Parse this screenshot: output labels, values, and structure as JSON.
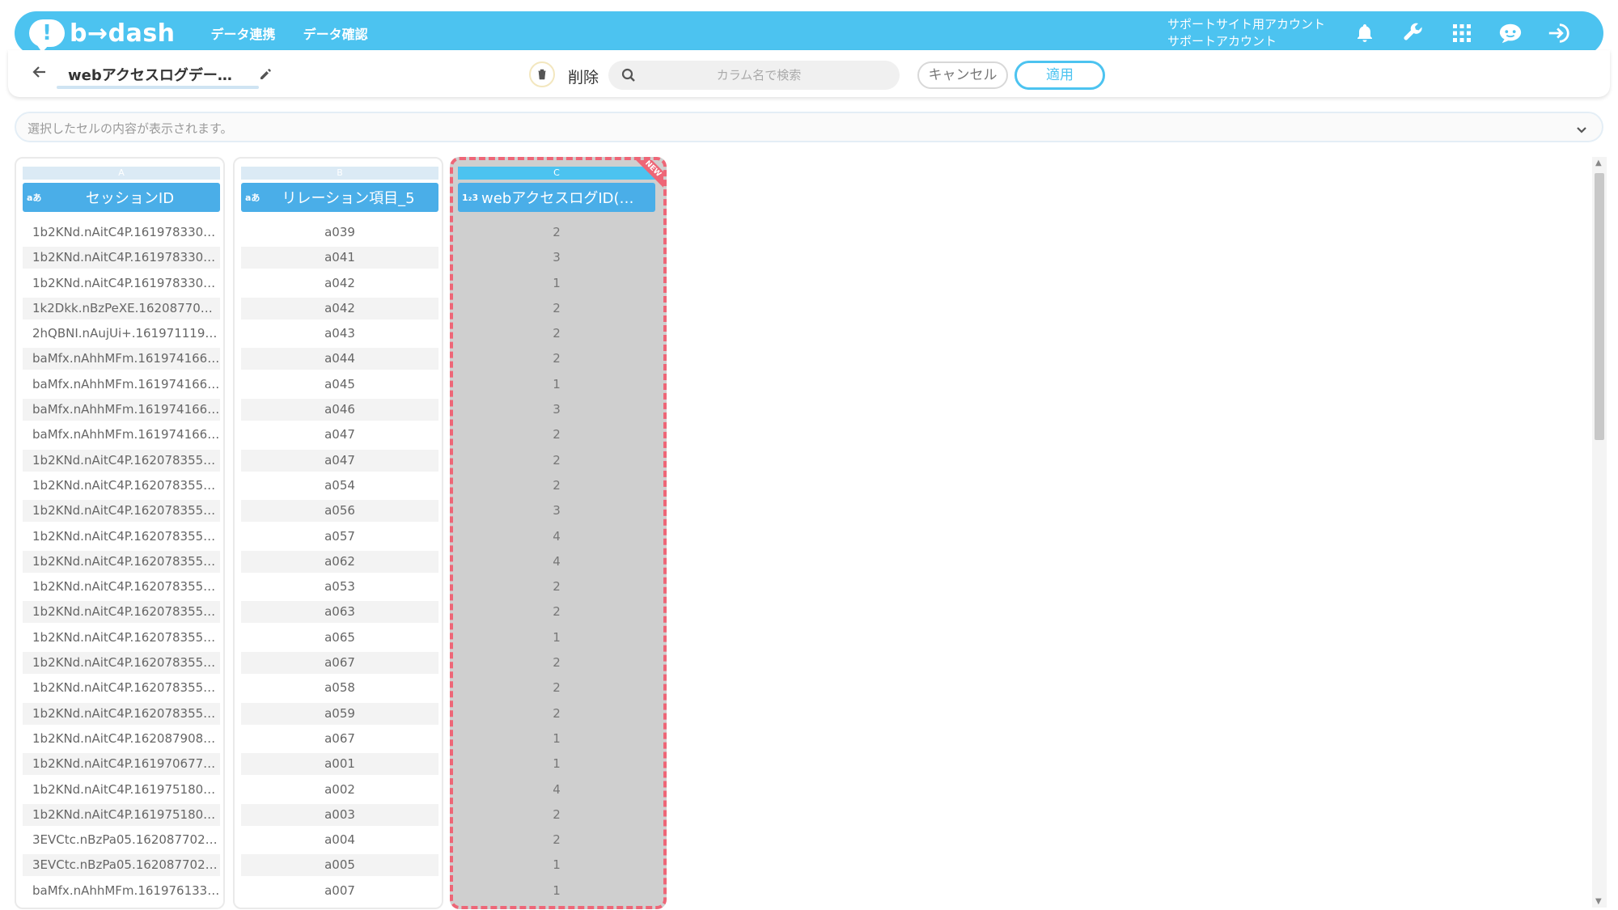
{
  "header": {
    "logo_mark": "!",
    "logo_text": "b→dash",
    "nav": [
      "データ連携",
      "データ確認"
    ],
    "account_line1": "サポートサイト用アカウント",
    "account_line2": "サポートアカウント",
    "icons": [
      "bell-icon",
      "wrench-icon",
      "apps-grid-icon",
      "support-chat-icon",
      "logout-icon"
    ],
    "bg_color": "#4cc3f0"
  },
  "toolbar": {
    "dataset_name": "webアクセスログデー…",
    "delete_label": "削除",
    "search_placeholder": "カラム名で検索",
    "cancel_label": "キャンセル",
    "apply_label": "適用"
  },
  "cellbar": {
    "placeholder": "選択したセルの内容が表示されます。"
  },
  "columns": [
    {
      "letter": "A",
      "type_icon": "aあ",
      "title": "セッションID",
      "cells": [
        "1b2KNd.nAitC4P.161978330…",
        "1b2KNd.nAitC4P.161978330…",
        "1b2KNd.nAitC4P.161978330…",
        "1k2Dkk.nBzPeXE.162087704…",
        "2hQBNI.nAujUi+.161971119…",
        "baMfx.nAhhMFm.161974166…",
        "baMfx.nAhhMFm.161974166…",
        "baMfx.nAhhMFm.161974166…",
        "baMfx.nAhhMFm.161974166…",
        "1b2KNd.nAitC4P.162078355…",
        "1b2KNd.nAitC4P.162078355…",
        "1b2KNd.nAitC4P.162078355…",
        "1b2KNd.nAitC4P.162078355…",
        "1b2KNd.nAitC4P.162078355…",
        "1b2KNd.nAitC4P.162078355…",
        "1b2KNd.nAitC4P.162078355…",
        "1b2KNd.nAitC4P.162078355…",
        "1b2KNd.nAitC4P.162078355…",
        "1b2KNd.nAitC4P.162078355…",
        "1b2KNd.nAitC4P.162078355…",
        "1b2KNd.nAitC4P.162087908…",
        "1b2KNd.nAitC4P.161970677…",
        "1b2KNd.nAitC4P.161975180…",
        "1b2KNd.nAitC4P.161975180…",
        "3EVCtc.nBzPa05.162087702…",
        "3EVCtc.nBzPa05.162087702…",
        "baMfx.nAhhMFm.161976133…"
      ]
    },
    {
      "letter": "B",
      "type_icon": "aあ",
      "title": "リレーション項目_5",
      "cells": [
        "a039",
        "a041",
        "a042",
        "a042",
        "a043",
        "a044",
        "a045",
        "a046",
        "a047",
        "a047",
        "a054",
        "a056",
        "a057",
        "a062",
        "a053",
        "a063",
        "a065",
        "a067",
        "a058",
        "a059",
        "a067",
        "a001",
        "a002",
        "a003",
        "a004",
        "a005",
        "a007"
      ]
    },
    {
      "letter": "C",
      "type_icon": "1₂3",
      "title": "webアクセスログID(…",
      "new_badge": "NEW",
      "cells": [
        "2",
        "3",
        "1",
        "2",
        "2",
        "2",
        "1",
        "3",
        "2",
        "2",
        "2",
        "3",
        "4",
        "4",
        "2",
        "2",
        "1",
        "2",
        "2",
        "2",
        "1",
        "1",
        "4",
        "2",
        "2",
        "1",
        "1"
      ]
    }
  ]
}
